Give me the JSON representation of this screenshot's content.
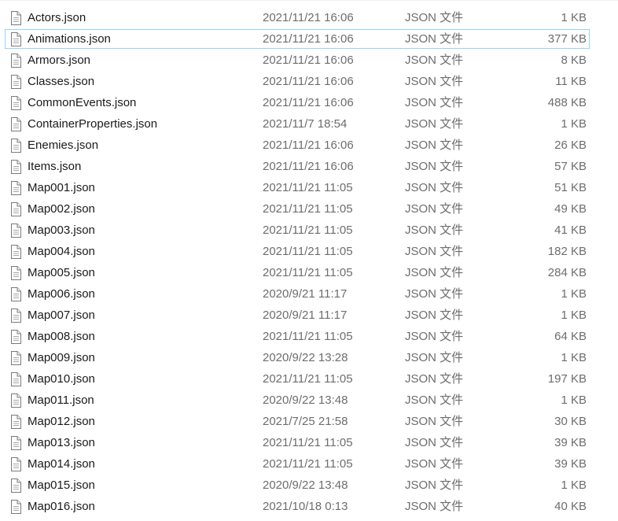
{
  "files": [
    {
      "name": "Actors.json",
      "date": "2021/11/21 16:06",
      "type": "JSON 文件",
      "size": "1 KB"
    },
    {
      "name": "Animations.json",
      "date": "2021/11/21 16:06",
      "type": "JSON 文件",
      "size": "377 KB"
    },
    {
      "name": "Armors.json",
      "date": "2021/11/21 16:06",
      "type": "JSON 文件",
      "size": "8 KB"
    },
    {
      "name": "Classes.json",
      "date": "2021/11/21 16:06",
      "type": "JSON 文件",
      "size": "11 KB"
    },
    {
      "name": "CommonEvents.json",
      "date": "2021/11/21 16:06",
      "type": "JSON 文件",
      "size": "488 KB"
    },
    {
      "name": "ContainerProperties.json",
      "date": "2021/11/7 18:54",
      "type": "JSON 文件",
      "size": "1 KB"
    },
    {
      "name": "Enemies.json",
      "date": "2021/11/21 16:06",
      "type": "JSON 文件",
      "size": "26 KB"
    },
    {
      "name": "Items.json",
      "date": "2021/11/21 16:06",
      "type": "JSON 文件",
      "size": "57 KB"
    },
    {
      "name": "Map001.json",
      "date": "2021/11/21 11:05",
      "type": "JSON 文件",
      "size": "51 KB"
    },
    {
      "name": "Map002.json",
      "date": "2021/11/21 11:05",
      "type": "JSON 文件",
      "size": "49 KB"
    },
    {
      "name": "Map003.json",
      "date": "2021/11/21 11:05",
      "type": "JSON 文件",
      "size": "41 KB"
    },
    {
      "name": "Map004.json",
      "date": "2021/11/21 11:05",
      "type": "JSON 文件",
      "size": "182 KB"
    },
    {
      "name": "Map005.json",
      "date": "2021/11/21 11:05",
      "type": "JSON 文件",
      "size": "284 KB"
    },
    {
      "name": "Map006.json",
      "date": "2020/9/21 11:17",
      "type": "JSON 文件",
      "size": "1 KB"
    },
    {
      "name": "Map007.json",
      "date": "2020/9/21 11:17",
      "type": "JSON 文件",
      "size": "1 KB"
    },
    {
      "name": "Map008.json",
      "date": "2021/11/21 11:05",
      "type": "JSON 文件",
      "size": "64 KB"
    },
    {
      "name": "Map009.json",
      "date": "2020/9/22 13:28",
      "type": "JSON 文件",
      "size": "1 KB"
    },
    {
      "name": "Map010.json",
      "date": "2021/11/21 11:05",
      "type": "JSON 文件",
      "size": "197 KB"
    },
    {
      "name": "Map011.json",
      "date": "2020/9/22 13:48",
      "type": "JSON 文件",
      "size": "1 KB"
    },
    {
      "name": "Map012.json",
      "date": "2021/7/25 21:58",
      "type": "JSON 文件",
      "size": "30 KB"
    },
    {
      "name": "Map013.json",
      "date": "2021/11/21 11:05",
      "type": "JSON 文件",
      "size": "39 KB"
    },
    {
      "name": "Map014.json",
      "date": "2021/11/21 11:05",
      "type": "JSON 文件",
      "size": "39 KB"
    },
    {
      "name": "Map015.json",
      "date": "2020/9/22 13:48",
      "type": "JSON 文件",
      "size": "1 KB"
    },
    {
      "name": "Map016.json",
      "date": "2021/10/18 0:13",
      "type": "JSON 文件",
      "size": "40 KB"
    }
  ],
  "focused_index": 1,
  "colors": {
    "focus_border": "#99d1ff",
    "secondary_text": "#6d6d6d",
    "icon_stroke": "#7a7a7a"
  },
  "icon": "document-icon"
}
